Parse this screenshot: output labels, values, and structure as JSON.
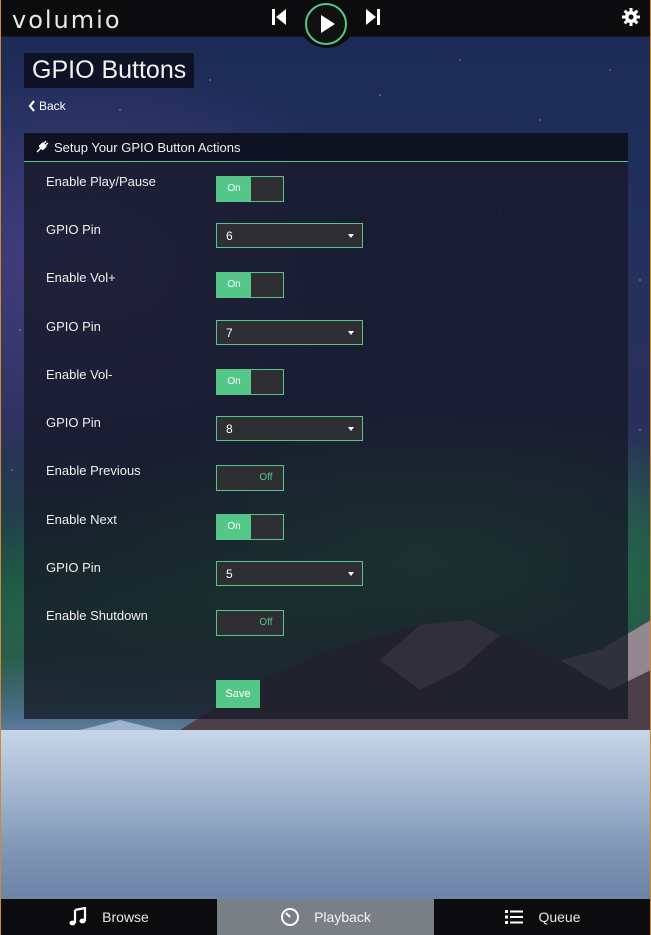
{
  "app": {
    "logo_text": "volumio",
    "accent_color": "#54c688"
  },
  "topbar": {
    "prev_icon": "skip-back-icon",
    "play_icon": "play-icon",
    "next_icon": "skip-forward-icon",
    "settings_icon": "gear-icon"
  },
  "page": {
    "title": "GPIO Buttons",
    "back_label": "Back"
  },
  "panel": {
    "heading": "Setup Your GPIO Button Actions",
    "heading_icon": "plug-icon",
    "rows": [
      {
        "label": "Enable Play/Pause",
        "type": "toggle",
        "state": "On"
      },
      {
        "label": "GPIO Pin",
        "type": "select",
        "value": "6"
      },
      {
        "label": "Enable Vol+",
        "type": "toggle",
        "state": "On"
      },
      {
        "label": "GPIO Pin",
        "type": "select",
        "value": "7"
      },
      {
        "label": "Enable Vol-",
        "type": "toggle",
        "state": "On"
      },
      {
        "label": "GPIO Pin",
        "type": "select",
        "value": "8"
      },
      {
        "label": "Enable Previous",
        "type": "toggle",
        "state": "Off"
      },
      {
        "label": "Enable Next",
        "type": "toggle",
        "state": "On"
      },
      {
        "label": "GPIO Pin",
        "type": "select",
        "value": "5"
      },
      {
        "label": "Enable Shutdown",
        "type": "toggle",
        "state": "Off"
      }
    ],
    "save_label": "Save"
  },
  "bottom_nav": {
    "items": [
      {
        "label": "Browse",
        "icon": "music-note-icon",
        "active": false
      },
      {
        "label": "Playback",
        "icon": "clock-dial-icon",
        "active": true
      },
      {
        "label": "Queue",
        "icon": "list-icon",
        "active": false
      }
    ]
  }
}
